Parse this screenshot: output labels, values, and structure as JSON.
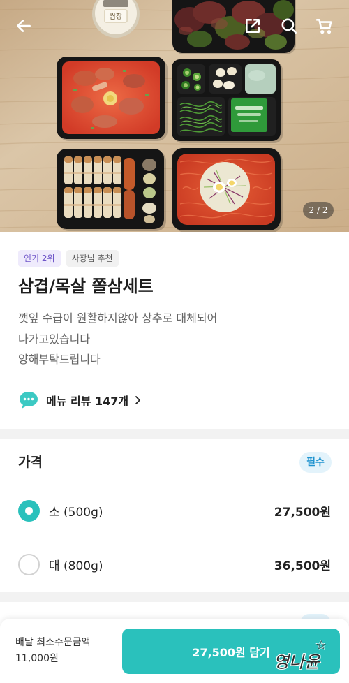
{
  "header": {
    "icons": [
      "back-arrow-icon",
      "share-icon",
      "search-icon",
      "cart-icon"
    ]
  },
  "hero": {
    "sauce_label": "쌈장",
    "image_counter": "2 / 2"
  },
  "badges": [
    {
      "label": "인기 2위",
      "bg": "#efebfc",
      "color": "#6f55c9"
    },
    {
      "label": "사장님 추천",
      "bg": "#f1f1f1",
      "color": "#555555"
    }
  ],
  "menu": {
    "title": "삼겹/목살 쫄삼세트",
    "description_lines": [
      "깻잎 수급이 원활하지않아 상추로 대체되어",
      "나가고있습니다",
      "양해부탁드립니다"
    ],
    "review_link": "메뉴 리뷰 147개"
  },
  "price_section": {
    "title": "가격",
    "required_badge": "필수",
    "options": [
      {
        "label": "소 (500g)",
        "price": "27,500원",
        "selected": true
      },
      {
        "label": "대 (800g)",
        "price": "36,500원",
        "selected": false
      }
    ]
  },
  "bottom_bar": {
    "min_order_label": "배달 최소주문금액",
    "min_order_value": "11,000원",
    "add_to_cart_button": "27,500원 담기"
  },
  "watermark": "영나윤",
  "colors": {
    "accent": "#2ac1bc",
    "required_badge_bg": "#e3f3fb",
    "required_badge_text": "#1f93cf",
    "divider": "#f2f2f2",
    "review_icon": "#3cc9c3"
  }
}
